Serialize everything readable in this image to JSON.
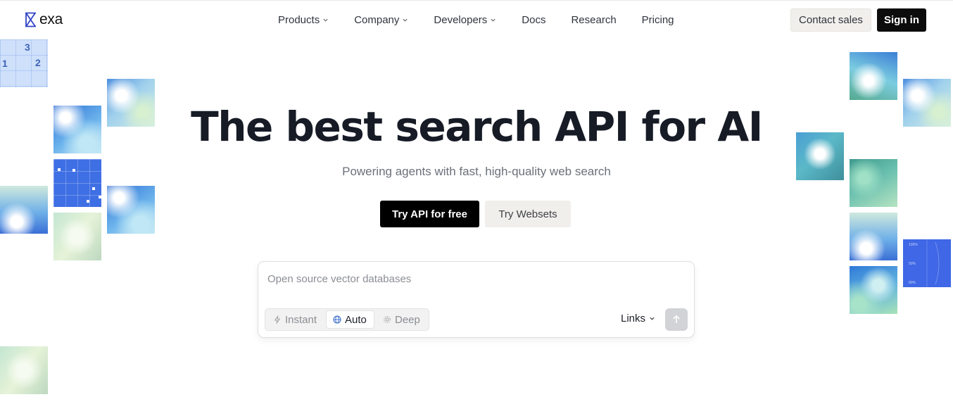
{
  "brand": {
    "name": "exa"
  },
  "nav": {
    "items": [
      {
        "label": "Products",
        "dropdown": true
      },
      {
        "label": "Company",
        "dropdown": true
      },
      {
        "label": "Developers",
        "dropdown": true
      },
      {
        "label": "Docs",
        "dropdown": false
      },
      {
        "label": "Research",
        "dropdown": false
      },
      {
        "label": "Pricing",
        "dropdown": false
      }
    ]
  },
  "header": {
    "contact_label": "Contact sales",
    "signin_label": "Sign in"
  },
  "hero": {
    "title": "The best search API for AI",
    "subtitle": "Powering agents with fast, high-quality web search",
    "primary_cta": "Try API for free",
    "secondary_cta": "Try Websets"
  },
  "search": {
    "placeholder": "Open source vector databases",
    "modes": [
      {
        "label": "Instant",
        "icon": "bolt-icon",
        "selected": false
      },
      {
        "label": "Auto",
        "icon": "globe-icon",
        "selected": true
      },
      {
        "label": "Deep",
        "icon": "gear-icon",
        "selected": false
      }
    ],
    "result_type": "Links",
    "submit_icon": "arrow-up-icon"
  },
  "decor": {
    "grid_numbers": [
      "3",
      "1",
      "2"
    ],
    "chart_labels": [
      "100%",
      "50%",
      "80%"
    ]
  },
  "colors": {
    "primary_button": "#000000",
    "secondary_button": "#f1efec",
    "logo": "#3245c6"
  }
}
